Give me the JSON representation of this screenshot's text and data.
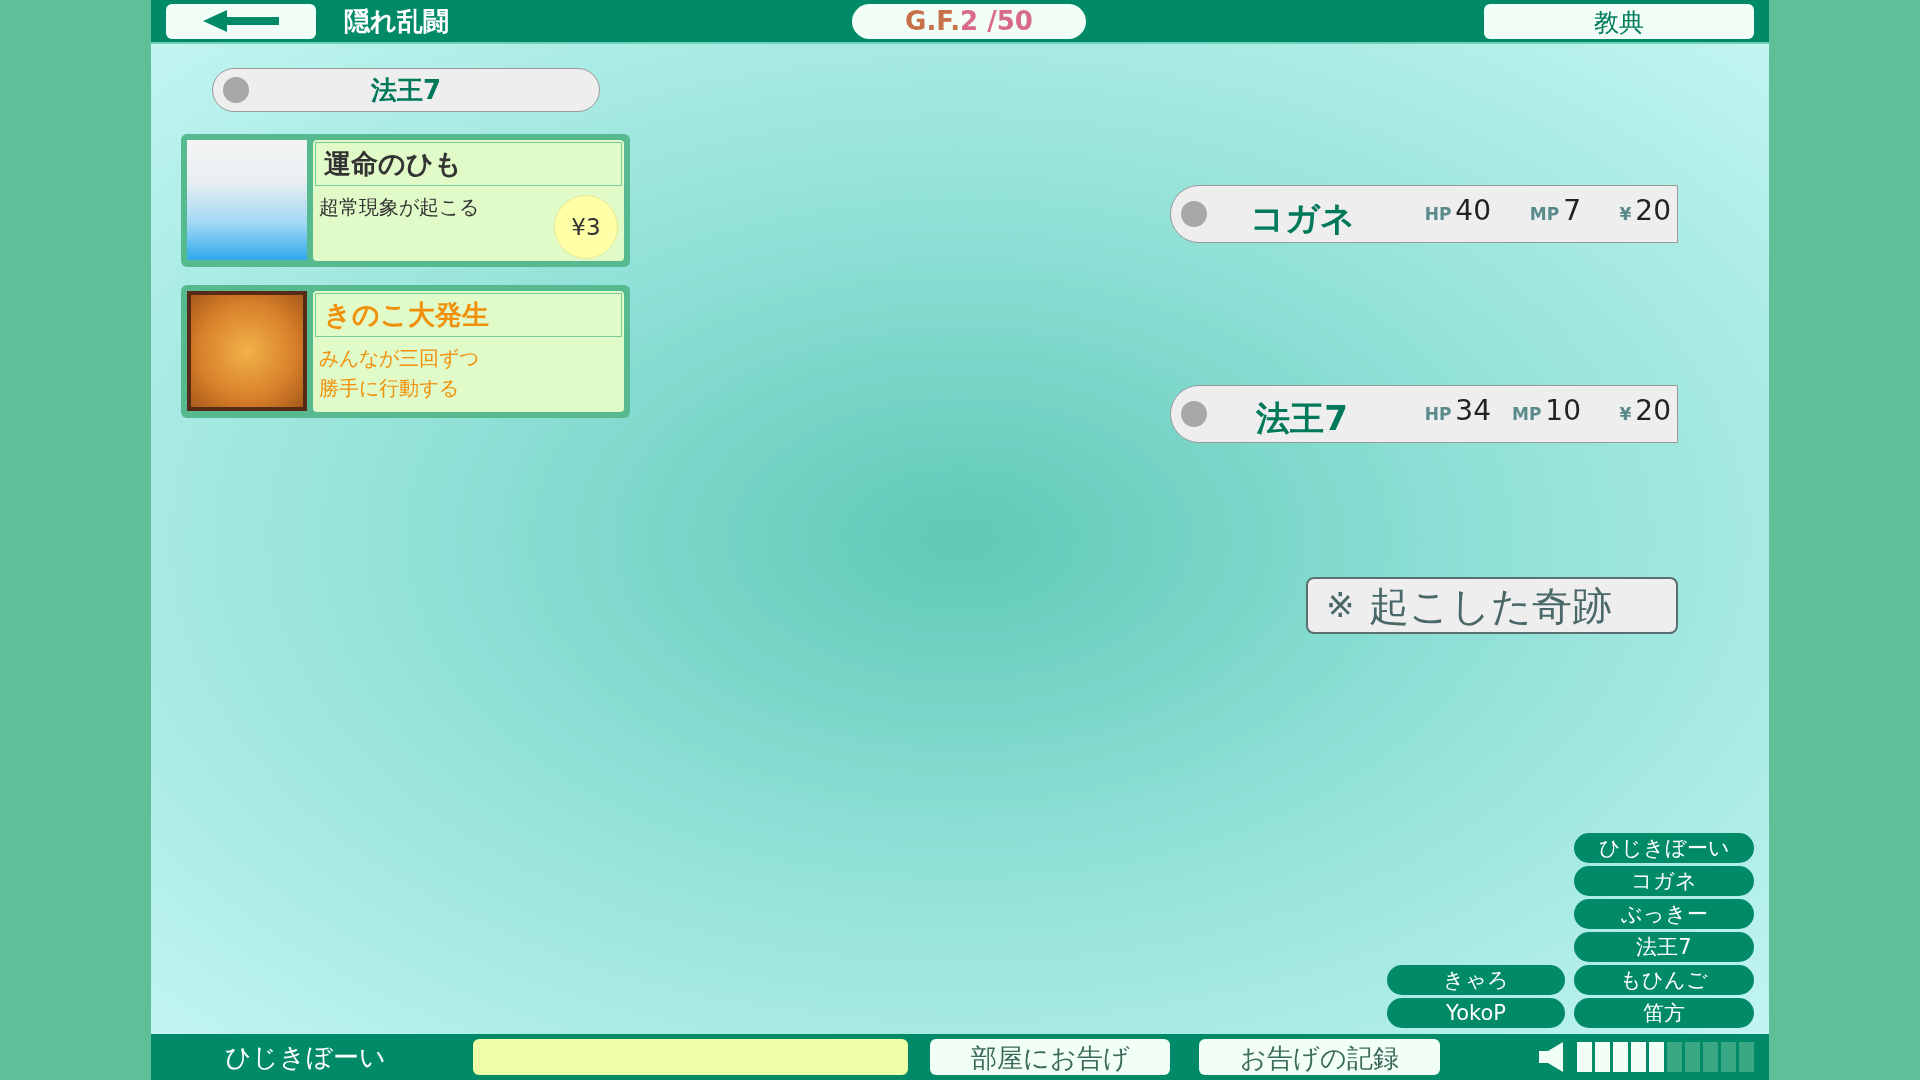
{
  "header": {
    "title": "隠れ乱闘",
    "turn": {
      "prefix": "G.F.",
      "current": "2",
      "total": " /50"
    },
    "book_button": "教典"
  },
  "current_player": "法王7",
  "cards": [
    {
      "title": "運命のひも",
      "description": [
        "超常現象が起こる"
      ],
      "cost": "¥3",
      "color": "#333333",
      "kind": "sky"
    },
    {
      "title": "きのこ大発生",
      "description": [
        "みんなが三回ずつ",
        "勝手に行動する"
      ],
      "color": "#f0900a",
      "kind": "mushroom"
    }
  ],
  "status_rows": [
    {
      "name": "コガネ",
      "stats": [
        {
          "label": "HP",
          "value": "40"
        },
        {
          "label": "MP",
          "value": "7"
        },
        {
          "label": "¥",
          "value": "20"
        }
      ]
    },
    {
      "name": "法王7",
      "stats": [
        {
          "label": "HP",
          "value": "34"
        },
        {
          "label": "MP",
          "value": "10"
        },
        {
          "label": "¥",
          "value": "20"
        }
      ]
    }
  ],
  "miracles_button": {
    "mark": "※",
    "label": "起こした奇跡"
  },
  "players_left": [
    "きゃろ",
    "YokoP"
  ],
  "players_right": [
    "ひじきぼーい",
    "コガネ",
    "ぶっきー",
    "法王7",
    "もひんご",
    "笛方"
  ],
  "footer": {
    "user": "ひじきぼーい",
    "announce_button": "部屋にお告げ",
    "log_button": "お告げの記録",
    "volume": {
      "level": 0.5
    }
  }
}
